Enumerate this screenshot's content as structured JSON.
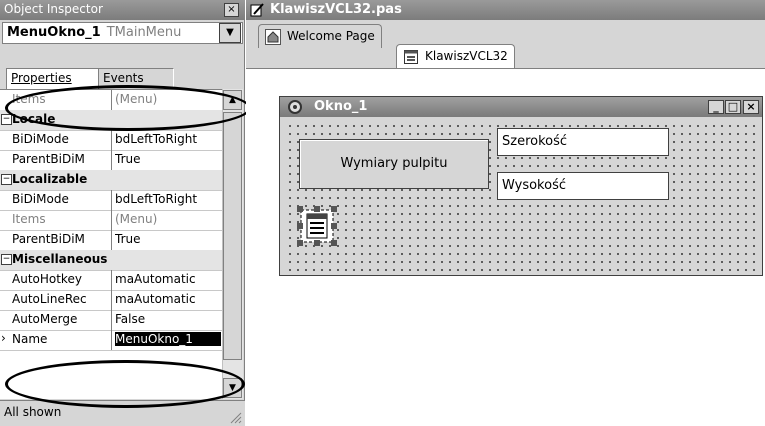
{
  "inspector": {
    "title": "Object Inspector",
    "close_glyph": "×",
    "component_name": "MenuOkno_1",
    "component_type": "TMainMenu",
    "tabs": [
      "Properties",
      "Events"
    ],
    "status": "All shown",
    "rows": [
      {
        "kind": "prop",
        "name": "Items",
        "value": "(Menu)",
        "gray": true
      },
      {
        "kind": "cat",
        "name": "Locale"
      },
      {
        "kind": "prop",
        "name": "BiDiMode",
        "value": "bdLeftToRight"
      },
      {
        "kind": "prop",
        "name": "ParentBiDiM",
        "value": "True"
      },
      {
        "kind": "cat",
        "name": "Localizable"
      },
      {
        "kind": "prop",
        "name": "BiDiMode",
        "value": "bdLeftToRight"
      },
      {
        "kind": "prop",
        "name": "Items",
        "value": "(Menu)",
        "gray": true
      },
      {
        "kind": "prop",
        "name": "ParentBiDiM",
        "value": "True"
      },
      {
        "kind": "cat",
        "name": "Miscellaneous"
      },
      {
        "kind": "prop",
        "name": "AutoHotkey",
        "value": "maAutomatic"
      },
      {
        "kind": "prop",
        "name": "AutoLineRec",
        "value": "maAutomatic"
      },
      {
        "kind": "prop",
        "name": "AutoMerge",
        "value": "False"
      },
      {
        "kind": "prop",
        "name": "Name",
        "value": "MenuOkno_1",
        "selected": true
      }
    ]
  },
  "editor": {
    "title": "KlawiszVCL32.pas",
    "tabs": [
      "Welcome Page",
      "KlawiszVCL32"
    ]
  },
  "form": {
    "title": "Okno_1",
    "button_label": "Wymiary pulpitu",
    "edit1_value": "Szerokość",
    "edit2_value": "Wysokość"
  }
}
